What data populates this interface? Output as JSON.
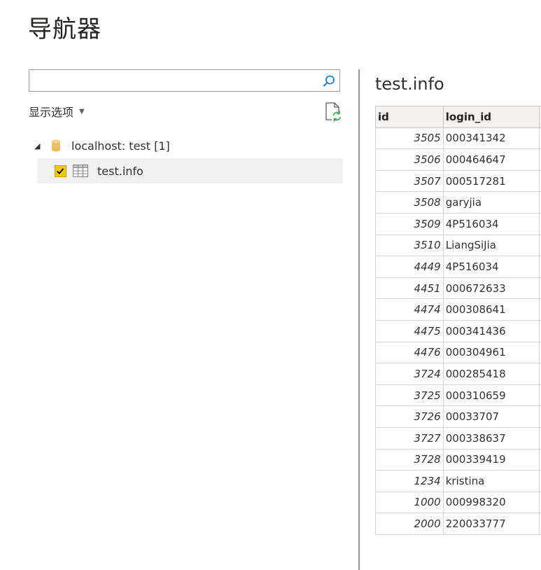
{
  "window": {
    "title": "导航器"
  },
  "search": {
    "value": "",
    "placeholder": ""
  },
  "display_options": {
    "label": "显示选项"
  },
  "tree": {
    "server": {
      "label": "localhost: test [1]"
    },
    "table": {
      "label": "test.info",
      "checked": true
    }
  },
  "preview": {
    "title": "test.info",
    "columns": [
      "id",
      "login_id"
    ],
    "rows": [
      {
        "id": "3505",
        "login_id": "000341342"
      },
      {
        "id": "3506",
        "login_id": "000464647"
      },
      {
        "id": "3507",
        "login_id": "000517281"
      },
      {
        "id": "3508",
        "login_id": "garyjia"
      },
      {
        "id": "3509",
        "login_id": "4P516034"
      },
      {
        "id": "3510",
        "login_id": "LiangSiJia"
      },
      {
        "id": "4449",
        "login_id": "4P516034"
      },
      {
        "id": "4451",
        "login_id": "000672633"
      },
      {
        "id": "4474",
        "login_id": "000308641"
      },
      {
        "id": "4475",
        "login_id": "000341436"
      },
      {
        "id": "4476",
        "login_id": "000304961"
      },
      {
        "id": "3724",
        "login_id": "000285418"
      },
      {
        "id": "3725",
        "login_id": "000310659"
      },
      {
        "id": "3726",
        "login_id": "00033707"
      },
      {
        "id": "3727",
        "login_id": "000338637"
      },
      {
        "id": "3728",
        "login_id": "000339419"
      },
      {
        "id": "1234",
        "login_id": "kristina"
      },
      {
        "id": "1000",
        "login_id": "000998320"
      },
      {
        "id": "2000",
        "login_id": "220033777"
      }
    ]
  },
  "colors": {
    "checkbox": "#f2c811",
    "database_icon": "#e8c06a",
    "refresh_arrow": "#3aa655"
  },
  "icons": {
    "search": "search-icon",
    "refresh": "refresh-icon",
    "expand": "triangle-expanded-icon",
    "database": "database-icon",
    "table": "table-icon",
    "check": "checkmark-icon"
  }
}
